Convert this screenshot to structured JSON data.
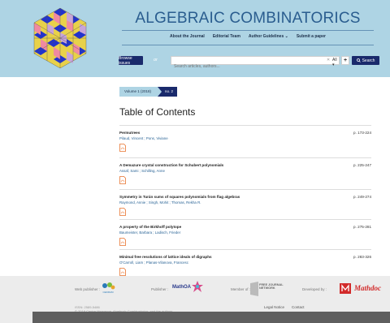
{
  "header": {
    "title": "ALGEBRAIC COMBINATORICS",
    "nav": [
      "About the Journal",
      "Editorial Team",
      "Author Guidelines ⌄",
      "Submit a paper"
    ],
    "browse_label": "Browse issues",
    "or_label": "or",
    "search_placeholder": "Search articles, authors...",
    "clear_label": "✕",
    "scope_label": "All ▾",
    "plus_label": "+",
    "search_button_label": "Search"
  },
  "breadcrumb": {
    "volume": "Volume 1 (2018)",
    "issue": "no. 2"
  },
  "toc_title": "Table of Contents",
  "articles": [
    {
      "title": "Permutrees",
      "authors": "Pilaud, Vincent ; Pons, Viviane",
      "pages": "p. 173-224"
    },
    {
      "title": "A Demazure crystal construction for Schubert polynomials",
      "authors": "Assaf, Sami ; Schilling, Anne",
      "pages": "p. 225-247"
    },
    {
      "title": "Symmetry in Turán sums of squares polynomials from flag algebras",
      "authors": "Raymond, Annie ; Singh, Mohit ; Thomas, Rekha R.",
      "pages": "p. 249-274"
    },
    {
      "title": "A property of the Birkhoff polytope",
      "authors": "Baumeister, Barbara ; Ladisch, Frieder",
      "pages": "p. 275-281"
    },
    {
      "title": "Minimal free resolutions of lattice ideals of digraphs",
      "authors": "O'Carroll, Liam ; Planas-Vilanova, Francesc",
      "pages": "p. 283-326"
    }
  ],
  "footer": {
    "web_publisher_label": "Web publisher :",
    "web_publisher_name": "CEDRAM",
    "publisher_label": "Publisher :",
    "publisher_name": "MathOA",
    "member_label": "Member of :",
    "member_name": "FREE JOURNAL NETWORK",
    "developed_label": "Developed by :",
    "developer_name": "Mathdoc",
    "issn": "ISSN: 2589-5486",
    "copyright": "© 2018 Centre Mersenne, Algebraic Combinatorics, and the authors",
    "legal": "Legal Notice",
    "contact": "Contact"
  },
  "colors": {
    "header_bg": "#aed4e4",
    "brand_dark": "#1a2a6c",
    "title_blue": "#2a5d8f",
    "pdf_orange": "#e8722c"
  }
}
